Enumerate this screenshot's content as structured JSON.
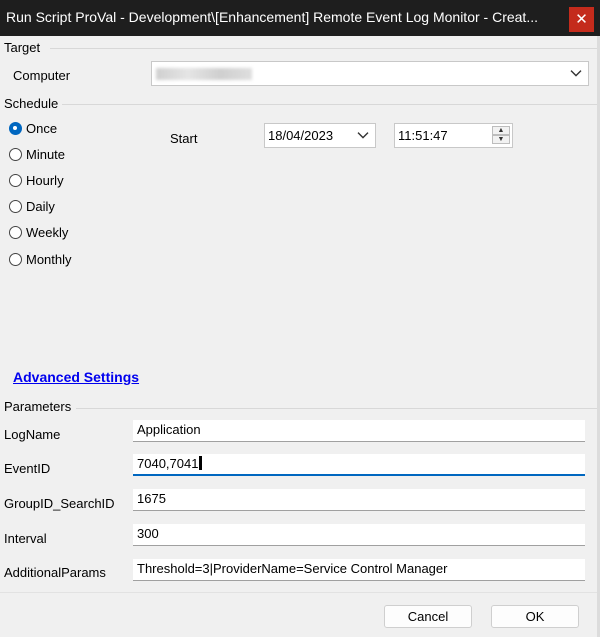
{
  "window": {
    "title": "Run Script ProVal - Development\\[Enhancement] Remote Event Log Monitor - Creat...",
    "close_glyph": "✕"
  },
  "target": {
    "group_label": "Target",
    "computer_label": "Computer"
  },
  "schedule": {
    "group_label": "Schedule",
    "options": [
      "Once",
      "Minute",
      "Hourly",
      "Daily",
      "Weekly",
      "Monthly"
    ],
    "selected": "Once",
    "start_label": "Start",
    "start_date": "18/04/2023",
    "start_time": "11:51:47"
  },
  "advanced_settings_label": "Advanced Settings",
  "parameters": {
    "group_label": "Parameters",
    "rows": [
      {
        "label": "LogName",
        "value": "Application"
      },
      {
        "label": "EventID",
        "value": "7040,7041"
      },
      {
        "label": "GroupID_SearchID",
        "value": "1675"
      },
      {
        "label": "Interval",
        "value": "300"
      },
      {
        "label": "AdditionalParams",
        "value": "Threshold=3|ProviderName=Service Control Manager"
      }
    ]
  },
  "buttons": {
    "cancel": "Cancel",
    "ok": "OK"
  },
  "icons": {
    "dropdown": "chevron-down-icon",
    "spin_up": "spin-up-icon",
    "spin_down": "spin-down-icon"
  },
  "colors": {
    "title_bar": "#1e1e1e",
    "close": "#c42b1c",
    "accent": "#0067c0",
    "link": "#0000ee"
  }
}
